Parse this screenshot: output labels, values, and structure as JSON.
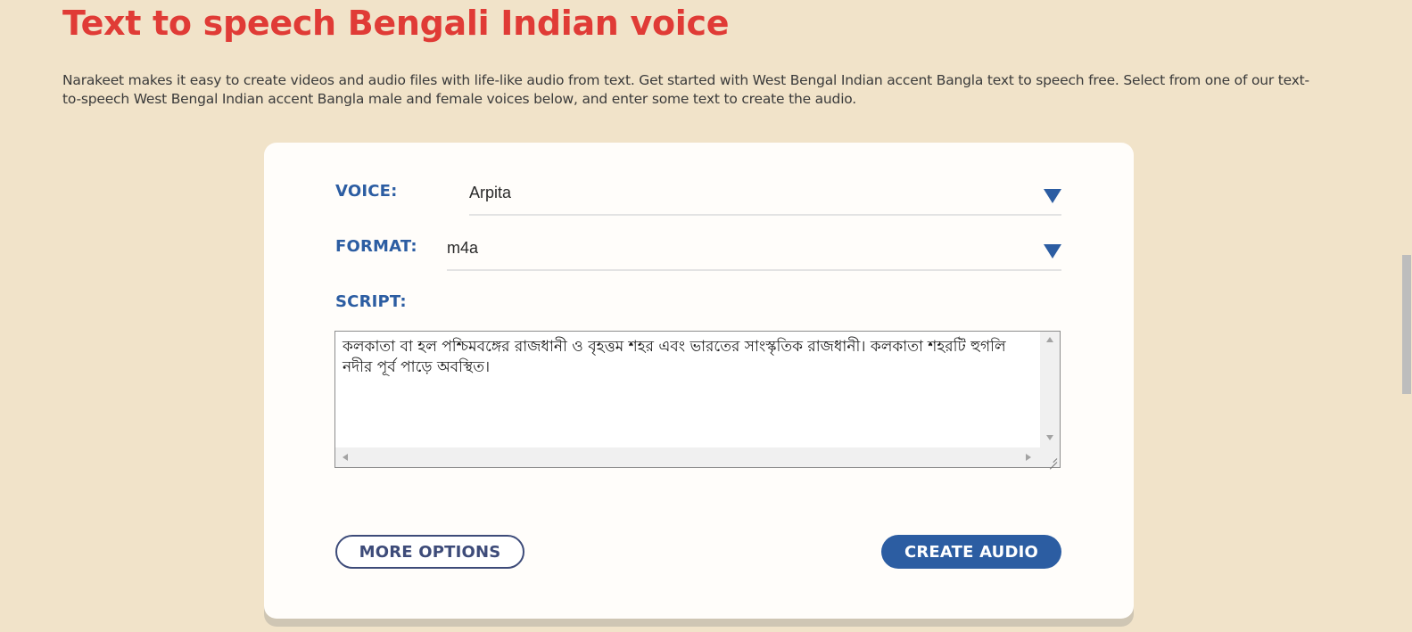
{
  "page": {
    "title": "Text to speech Bengali Indian voice",
    "intro": "Narakeet makes it easy to create videos and audio files with life-like audio from text. Get started with West Bengal Indian accent Bangla text to speech free. Select from one of our text-to-speech West Bengal Indian accent Bangla male and female voices below, and enter some text to create the audio."
  },
  "form": {
    "voice_label": "VOICE:",
    "voice_value": "Arpita",
    "format_label": "FORMAT:",
    "format_value": "m4a",
    "script_label": "SCRIPT:",
    "script_text": "কলকাতা বা হল পশ্চিমবঙ্গের রাজধানী ও বৃহত্তম শহর এবং ভারতের সাংস্কৃতিক রাজধানী। কলকাতা শহরটি হুগলি নদীর পূর্ব পাড়ে অবস্থিত।",
    "more_options_label": "MORE OPTIONS",
    "create_audio_label": "CREATE AUDIO"
  },
  "icons": {
    "dropdown": "chevron-down-icon",
    "resize": "resize-grip-icon"
  },
  "colors": {
    "background": "#f1e3c9",
    "title": "#e03b36",
    "accent": "#2c5da2",
    "outline_button": "#3d4b79",
    "card": "#fffdfa"
  }
}
